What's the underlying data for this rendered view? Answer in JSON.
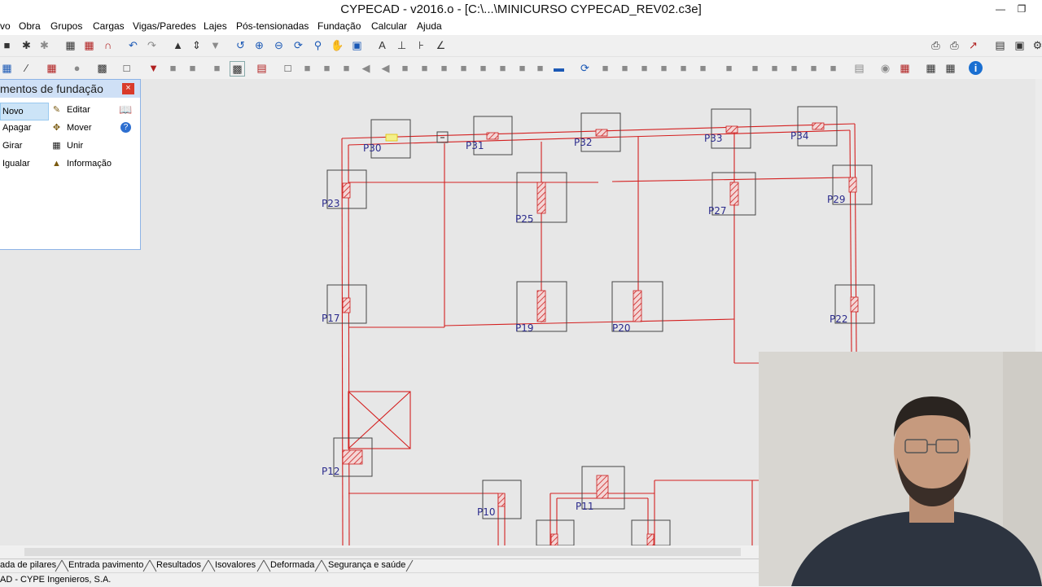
{
  "app": {
    "title": "CYPECAD - v2016.o - [C:\\...\\MINICURSO CYPECAD_REV02.c3e]",
    "accent_color": "#cc1f1f"
  },
  "window_controls": {
    "minimize_icon": "minimize-icon",
    "restore_icon": "restore-icon"
  },
  "menu": [
    "vo",
    "Obra",
    "Grupos",
    "Cargas",
    "Vigas/Paredes",
    "Lajes",
    "Pós-tensionadas",
    "Fundação",
    "Calcular",
    "Ajuda"
  ],
  "panel": {
    "title": "mentos de fundação",
    "buttons": [
      {
        "label": "Novo",
        "icon": "",
        "selected": true
      },
      {
        "label": "Editar",
        "icon": "edit-icon"
      },
      {
        "label": "Apagar",
        "icon": ""
      },
      {
        "label": "Mover",
        "icon": "move-icon"
      },
      {
        "label": "Girar",
        "icon": ""
      },
      {
        "label": "Unir",
        "icon": "join-icon"
      },
      {
        "label": "Igualar",
        "icon": ""
      },
      {
        "label": "Informação",
        "icon": "info-icon"
      }
    ],
    "side_icons": [
      "book-icon",
      "help-icon"
    ],
    "close_icon": "close-icon"
  },
  "drawing": {
    "pillars": [
      "P30",
      "P31",
      "P32",
      "P33",
      "P34",
      "P23",
      "P25",
      "P27",
      "P29",
      "P17",
      "P19",
      "P20",
      "P22",
      "P12",
      "P10",
      "P11"
    ]
  },
  "tabs": [
    "ada de pilares",
    "Entrada pavimento",
    "Resultados",
    "Isovalores",
    "Deformada",
    "Segurança e saúde"
  ],
  "status": {
    "text": "AD - CYPE Ingenieros, S.A."
  }
}
